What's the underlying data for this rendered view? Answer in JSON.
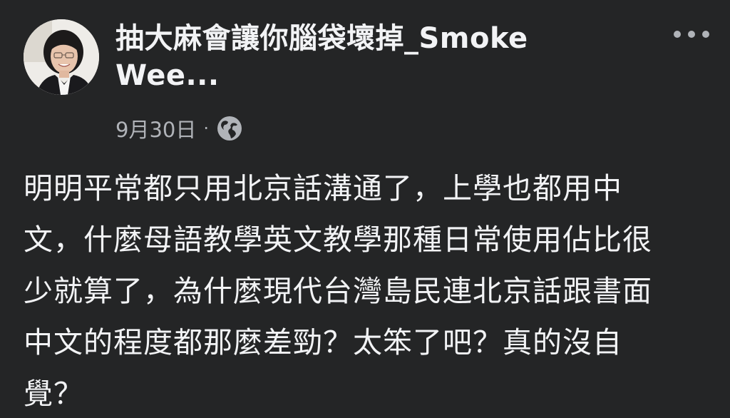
{
  "post": {
    "author_name": "抽大麻會讓你腦袋壞掉_Smoke Wee...",
    "date": "9月30日",
    "separator": "·",
    "privacy_icon": "globe-icon",
    "more_icon": "more-horizontal-icon",
    "body_lines": [
      "明明平常都只用北京話溝通了，上學也都用中",
      "文，什麼母語教學英文教學那種日常使用佔比很",
      "少就算了，為什麼現代台灣島民連北京話跟書面",
      "中文的程度都那麼差勁？太笨了吧？真的沒自",
      "覺？"
    ]
  },
  "colors": {
    "background": "#242526",
    "primary_text": "#f2f3f5",
    "secondary_text": "#b0b3b8"
  }
}
